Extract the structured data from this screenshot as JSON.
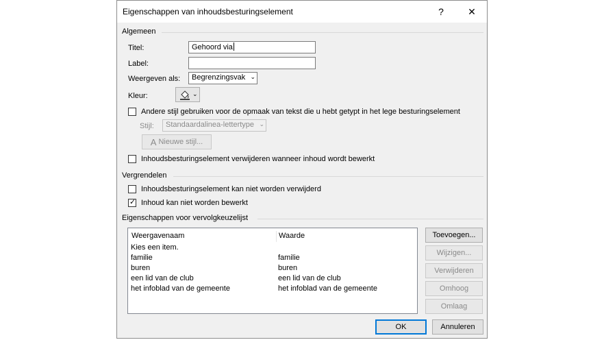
{
  "window": {
    "title": "Eigenschappen van inhoudsbesturingselement",
    "help_glyph": "?",
    "close_glyph": "✕"
  },
  "general": {
    "section_label": "Algemeen",
    "title_label": "Titel:",
    "title_value": "Gehoord via",
    "label_label": "Label:",
    "label_value": "",
    "display_as_label": "Weergeven als:",
    "display_as_value": "Begrenzingsvak",
    "color_label": "Kleur:",
    "color_icon": "paint-bucket-icon",
    "use_style_label": "Andere stijl gebruiken voor de opmaak van tekst die u hebt getypt in het lege besturingselement",
    "use_style_checked": false,
    "style_label": "Stijl:",
    "style_value": "Standaardalinea-lettertype",
    "new_style_label": "Nieuwe stijl...",
    "remove_control_label": "Inhoudsbesturingselement verwijderen wanneer inhoud wordt bewerkt",
    "remove_control_checked": false
  },
  "locking": {
    "section_label": "Vergrendelen",
    "cannot_delete_label": "Inhoudsbesturingselement kan niet worden verwijderd",
    "cannot_delete_checked": false,
    "cannot_edit_label": "Inhoud kan niet worden bewerkt",
    "cannot_edit_checked": true
  },
  "dropdown": {
    "section_label": "Eigenschappen voor vervolgkeuzelijst",
    "col_display": "Weergavenaam",
    "col_value": "Waarde",
    "rows": [
      {
        "display": "Kies een item.",
        "value": ""
      },
      {
        "display": "familie",
        "value": "familie"
      },
      {
        "display": "buren",
        "value": "buren"
      },
      {
        "display": "een lid van de club",
        "value": "een lid van de club"
      },
      {
        "display": "het infoblad van de gemeente",
        "value": "het infoblad van de gemeente"
      }
    ],
    "add_label": "Toevoegen...",
    "modify_label": "Wijzigen...",
    "remove_label": "Verwijderen",
    "up_label": "Omhoog",
    "down_label": "Omlaag"
  },
  "footer": {
    "ok_label": "OK",
    "cancel_label": "Annuleren"
  },
  "colors": {
    "dialog_bg": "#f0f0f0",
    "accent": "#0078d7",
    "disabled_text": "#8a8a8a"
  }
}
